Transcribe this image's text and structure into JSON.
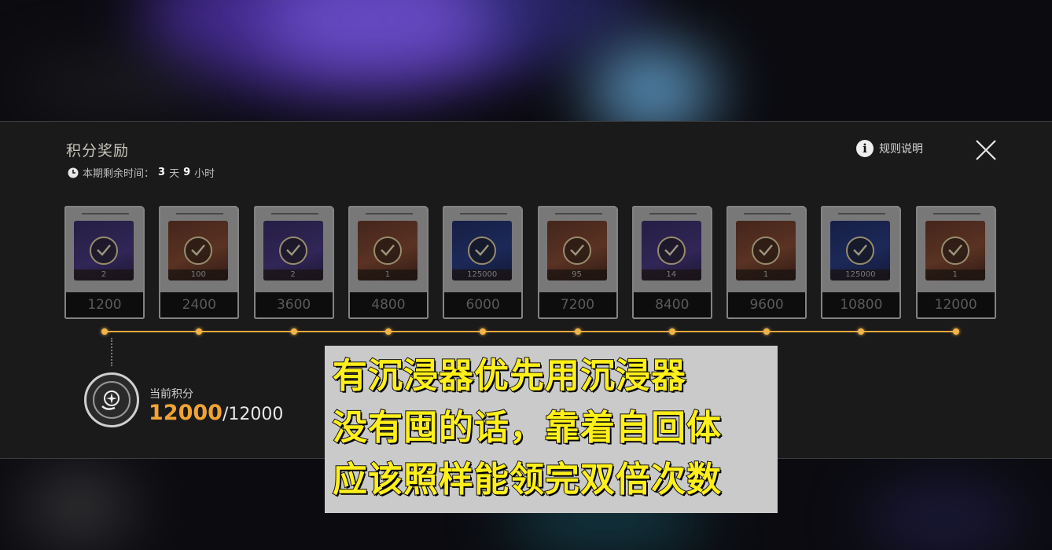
{
  "header": {
    "title": "积分奖励",
    "time_prefix": "本期剩余时间：",
    "days_value": "3",
    "days_unit": "天",
    "hours_value": "9",
    "hours_unit": "小时",
    "rules_label": "规则说明"
  },
  "rewards": [
    {
      "score": "1200",
      "qty": "2",
      "theme": "purple",
      "claimed": true
    },
    {
      "score": "2400",
      "qty": "100",
      "theme": "orange",
      "claimed": true
    },
    {
      "score": "3600",
      "qty": "2",
      "theme": "purple",
      "claimed": true
    },
    {
      "score": "4800",
      "qty": "1",
      "theme": "orange",
      "claimed": true
    },
    {
      "score": "6000",
      "qty": "125000",
      "theme": "blue",
      "claimed": true
    },
    {
      "score": "7200",
      "qty": "95",
      "theme": "orange",
      "claimed": true
    },
    {
      "score": "8400",
      "qty": "14",
      "theme": "purple",
      "claimed": true
    },
    {
      "score": "9600",
      "qty": "1",
      "theme": "orange",
      "claimed": true
    },
    {
      "score": "10800",
      "qty": "125000",
      "theme": "blue",
      "claimed": true
    },
    {
      "score": "12000",
      "qty": "1",
      "theme": "orange",
      "claimed": true
    }
  ],
  "progress": {
    "label": "当前积分",
    "current": "12000",
    "max": "/12000",
    "fraction": 1.0
  },
  "caption": {
    "line1": "有沉浸器优先用沉浸器",
    "line2": "没有囤的话，靠着自回体",
    "line3": "应该照样能领完双倍次数"
  },
  "colors": {
    "accent": "#f0a335",
    "track": "#e6a93e",
    "caption_text": "#ffef1a",
    "caption_bg": "#cacaca"
  }
}
